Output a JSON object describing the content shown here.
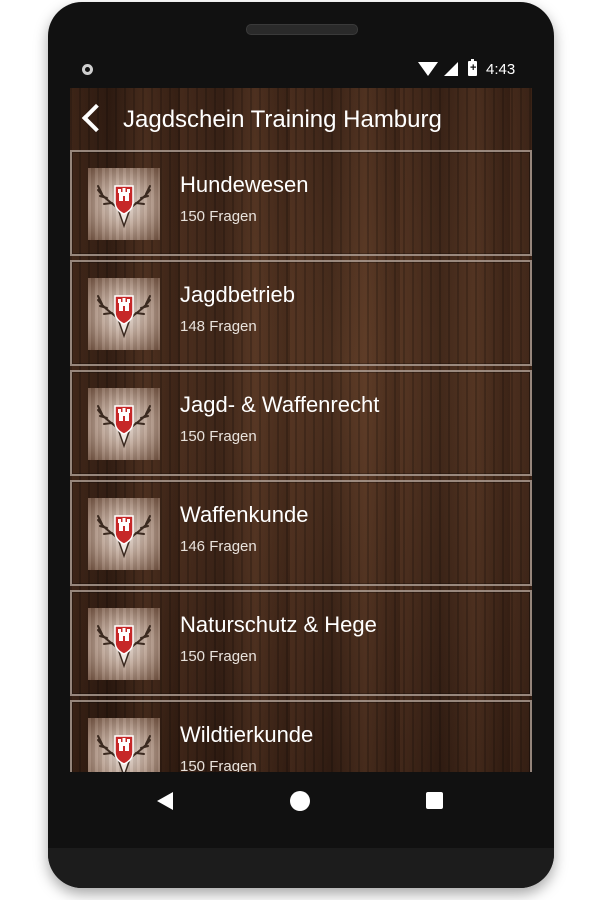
{
  "status_bar": {
    "time": "4:43",
    "battery_glyph": "+"
  },
  "header": {
    "title": "Jagdschein Training Hamburg"
  },
  "icons": {
    "back": "chevron-left-icon",
    "thumb": "hamburg-antler-crest-icon"
  },
  "colors": {
    "text": "#ffffff",
    "crest_red": "#c62828",
    "wood": "#3a2418"
  },
  "categories": [
    {
      "title": "Hundewesen",
      "count": "150 Fragen"
    },
    {
      "title": "Jagdbetrieb",
      "count": "148 Fragen"
    },
    {
      "title": "Jagd- & Waffenrecht",
      "count": "150 Fragen"
    },
    {
      "title": "Waffenkunde",
      "count": "146 Fragen"
    },
    {
      "title": "Naturschutz & Hege",
      "count": "150 Fragen"
    },
    {
      "title": "Wildtierkunde",
      "count": "150 Fragen"
    }
  ]
}
